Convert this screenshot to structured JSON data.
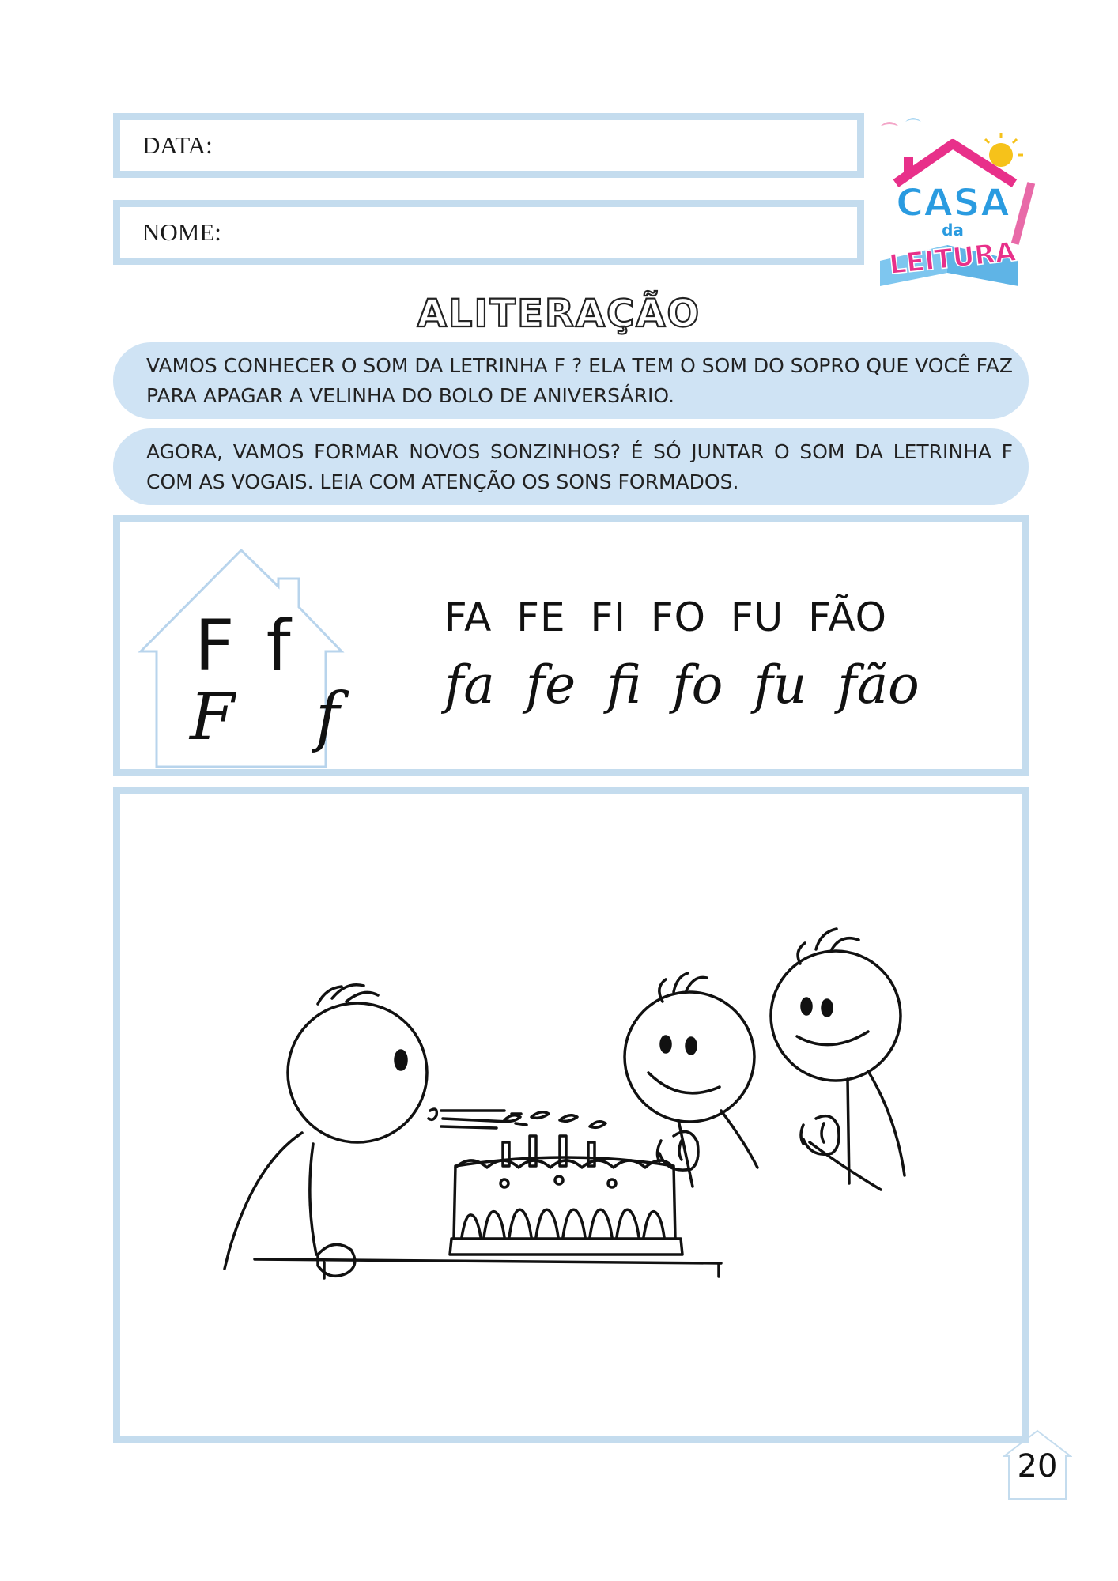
{
  "header": {
    "date_label": "DATA:",
    "name_label": "NOME:"
  },
  "logo": {
    "line1": "CASA",
    "line2": "da",
    "line3": "LEITURA",
    "colors": {
      "pink": "#e8308a",
      "blue": "#2a9be0",
      "yellow": "#f6c21a"
    }
  },
  "title": "ALITERAÇÃO",
  "instructions": [
    "VAMOS CONHECER O SOM DA LETRINHA F ? ELA TEM O SOM DO SOPRO QUE VOCÊ FAZ PARA APAGAR A VELINHA DO BOLO DE ANIVERSÁRIO.",
    "AGORA, VAMOS FORMAR NOVOS SONZINHOS? É SÓ JUNTAR O SOM DA LETRINHA F COM AS VOGAIS. LEIA COM ATENÇÃO OS SONS FORMADOS."
  ],
  "letter_house": {
    "print": "F f",
    "cursive": "F f"
  },
  "syllables": {
    "print": "FA FE FI FO FU FÃO",
    "cursive": "fa fe fi fo fu fão"
  },
  "illustration": {
    "description_icon": "children-birthday-cake-icon"
  },
  "page_number": "20",
  "colors": {
    "frame": "#c4dcee",
    "bubble": "#cfe3f4"
  }
}
